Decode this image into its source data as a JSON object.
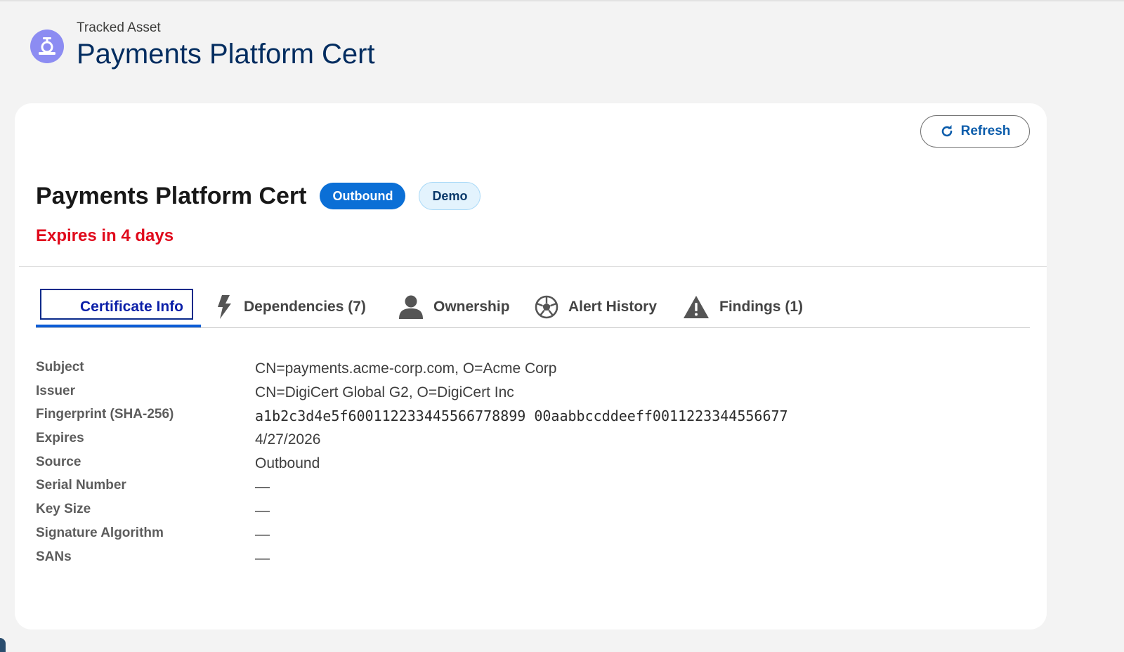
{
  "header": {
    "kicker": "Tracked Asset",
    "title": "Payments Platform Cert",
    "icon": "certificate-icon",
    "icon_color": "#8c8cf2"
  },
  "actions": {
    "refresh_label": "Refresh",
    "refresh_icon": "refresh-icon"
  },
  "record": {
    "title": "Payments Platform Cert",
    "badges": [
      "Outbound",
      "Demo"
    ],
    "expiry_text": "Expires in 4 days",
    "expiry_color": "#e00a1c"
  },
  "tabs": [
    {
      "label": "Certificate Info",
      "icon": "",
      "active": true
    },
    {
      "label": "Dependencies (7)",
      "icon": "bolt-icon"
    },
    {
      "label": "Ownership",
      "icon": "user-icon"
    },
    {
      "label": "Alert History",
      "icon": "soccer-ball-icon"
    },
    {
      "label": "Findings (1)",
      "icon": "warning-icon"
    }
  ],
  "details": [
    {
      "label": "Subject",
      "value": "CN=payments.acme-corp.com, O=Acme Corp"
    },
    {
      "label": "Issuer",
      "value": "CN=DigiCert Global G2, O=DigiCert Inc"
    },
    {
      "label": "Fingerprint (SHA-256)",
      "value": "a1b2c3d4e5f600112233445566778899 00aabbccddeeff0011223344556677"
    },
    {
      "label": "Expires",
      "value": "4/27/2026"
    },
    {
      "label": "Source",
      "value": "Outbound"
    },
    {
      "label": "Serial Number",
      "value": "—"
    },
    {
      "label": "Key Size",
      "value": "—"
    },
    {
      "label": "Signature Algorithm",
      "value": "—"
    },
    {
      "label": "SANs",
      "value": "—"
    }
  ],
  "colors": {
    "brand_blue": "#0b5cab",
    "badge_outbound_bg": "#0b6fd6",
    "badge_demo_bg": "#e3f3fd",
    "active_tab": "#0b5cd6"
  }
}
